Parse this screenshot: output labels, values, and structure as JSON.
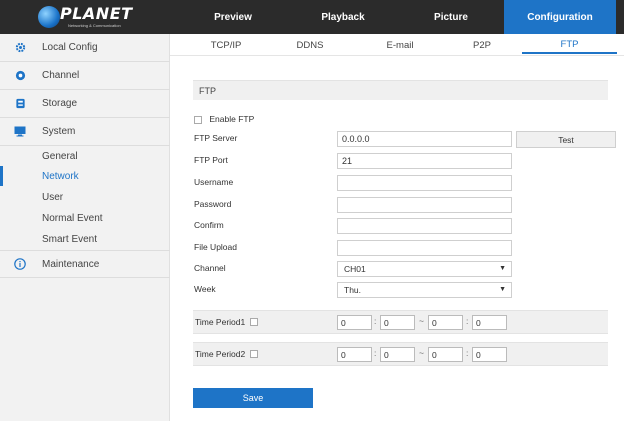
{
  "brand": {
    "name": "PLANET",
    "tagline": "Networking & Communication"
  },
  "top_nav": [
    "Preview",
    "Playback",
    "Picture",
    "Configuration"
  ],
  "top_nav_active": "Configuration",
  "sidebar": {
    "items": [
      {
        "label": "Local Config",
        "icon": "gear-icon"
      },
      {
        "label": "Channel",
        "icon": "camera-icon"
      },
      {
        "label": "Storage",
        "icon": "storage-icon"
      },
      {
        "label": "System",
        "icon": "monitor-icon"
      },
      {
        "label": "Maintenance",
        "icon": "info-icon"
      }
    ],
    "sub_items": [
      "General",
      "Network",
      "User",
      "Normal Event",
      "Smart Event"
    ],
    "active_sub": "Network"
  },
  "tabs": [
    "TCP/IP",
    "DDNS",
    "E-mail",
    "P2P",
    "FTP"
  ],
  "active_tab": "FTP",
  "form": {
    "section_title": "FTP",
    "enable_label": "Enable FTP",
    "server_label": "FTP Server",
    "server_value": "0.0.0.0",
    "test_label": "Test",
    "port_label": "FTP Port",
    "port_value": "21",
    "username_label": "Username",
    "username_value": "",
    "password_label": "Password",
    "password_value": "",
    "confirm_label": "Confirm",
    "confirm_value": "",
    "upload_label": "File Upload",
    "upload_value": "",
    "channel_label": "Channel",
    "channel_value": "CH01",
    "week_label": "Week",
    "week_value": "Thu.",
    "period1_label": "Time Period1",
    "period2_label": "Time Period2",
    "period1": [
      "0",
      "0",
      "0",
      "0"
    ],
    "period2": [
      "0",
      "0",
      "0",
      "0"
    ],
    "time_colon": ":",
    "time_dash": "~",
    "save_label": "Save"
  },
  "colors": {
    "accent": "#1e74c7",
    "topbar": "#2b2b2b",
    "sidebar": "#f2f2f2"
  }
}
